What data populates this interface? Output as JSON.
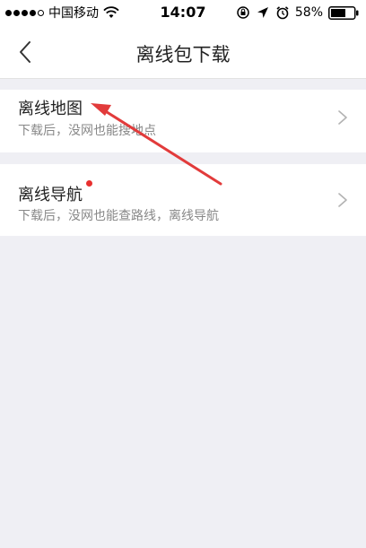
{
  "status_bar": {
    "carrier": "中国移动",
    "time": "14:07",
    "battery_percent": "58%",
    "icons": [
      "signal-dots",
      "wifi-icon",
      "rotation-lock-icon",
      "location-arrow-icon",
      "alarm-icon",
      "battery-icon"
    ]
  },
  "nav": {
    "back_icon": "chevron-left-icon",
    "title": "离线包下载"
  },
  "items": [
    {
      "title": "离线地图",
      "subtitle": "下载后，没网也能搜地点",
      "has_badge": false
    },
    {
      "title": "离线导航",
      "subtitle": "下载后，没网也能查路线，离线导航",
      "has_badge": true
    }
  ],
  "colors": {
    "background": "#efeff4",
    "badge": "#e8302e",
    "annotation_arrow": "#e23b3b"
  }
}
